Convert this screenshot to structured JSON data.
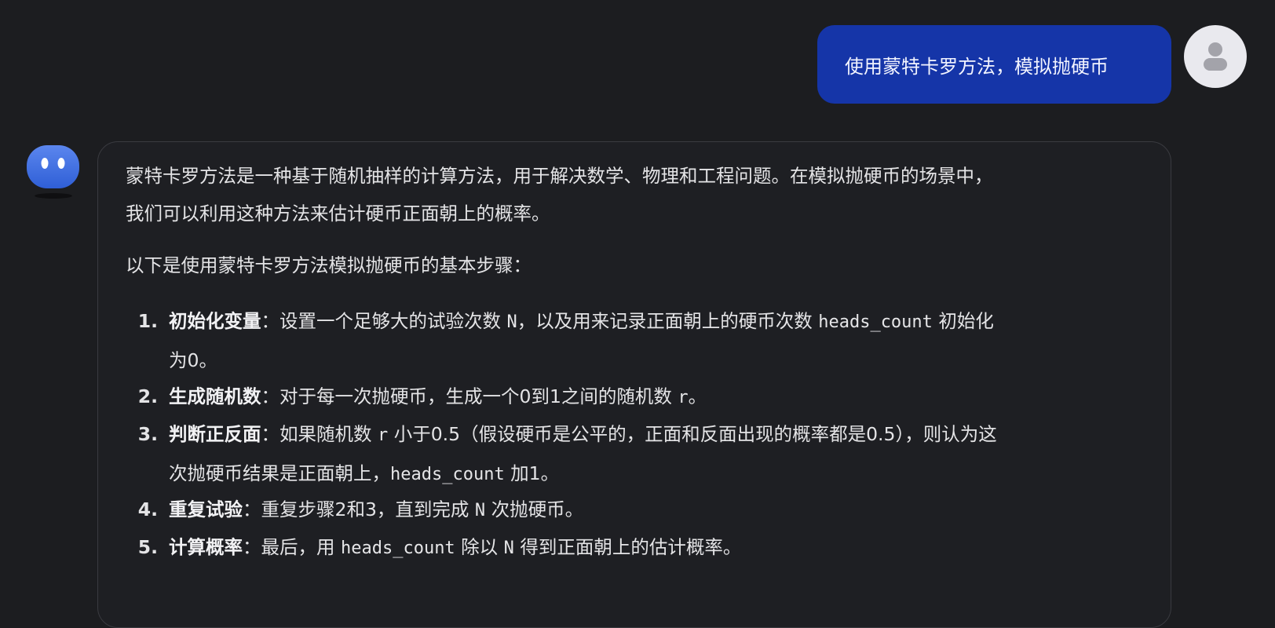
{
  "user_message": {
    "text": "使用蒙特卡罗方法，模拟抛硬币",
    "avatar_icon": "user-avatar-icon"
  },
  "assistant": {
    "avatar_icon": "bot-avatar-icon",
    "intro_line1": "蒙特卡罗方法是一种基于随机抽样的计算方法，用于解决数学、物理和工程问题。在模拟抛硬币的场景中，",
    "intro_line2": "我们可以利用这种方法来估计硬币正面朝上的概率。",
    "steps_intro": "以下是使用蒙特卡罗方法模拟抛硬币的基本步骤：",
    "steps": [
      {
        "num": "1.",
        "title": "初始化变量",
        "sep": "：",
        "p1": "设置一个足够大的试验次数 ",
        "code1": "N",
        "p2": "，以及用来记录正面朝上的硬币次数 ",
        "code2": "heads_count",
        "p3": " 初始化",
        "cont": "为0。"
      },
      {
        "num": "2.",
        "title": "生成随机数",
        "sep": "：",
        "p1": "对于每一次抛硬币，生成一个0到1之间的随机数 ",
        "code1": "r",
        "p2": "。"
      },
      {
        "num": "3.",
        "title": "判断正反面",
        "sep": "：",
        "p1": "如果随机数 ",
        "code1": "r",
        "p2": " 小于0.5（假设硬币是公平的，正面和反面出现的概率都是0.5），则认为这",
        "cont1": "次抛硬币结果是正面朝上，",
        "cont_code": "heads_count",
        "cont2": " 加1。"
      },
      {
        "num": "4.",
        "title": "重复试验",
        "sep": "：",
        "p1": "重复步骤2和3，直到完成 ",
        "code1": "N",
        "p2": " 次抛硬币。"
      },
      {
        "num": "5.",
        "title": "计算概率",
        "sep": "：",
        "p1": "最后，用 ",
        "code1": "heads_count",
        "p2": " 除以 ",
        "code2": "N",
        "p3": " 得到正面朝上的估计概率。"
      }
    ]
  },
  "colors": {
    "background": "#1c1d20",
    "user_bubble": "#1535a8",
    "bot_avatar": "#3f6fe0",
    "card_border": "#3a3b40"
  }
}
